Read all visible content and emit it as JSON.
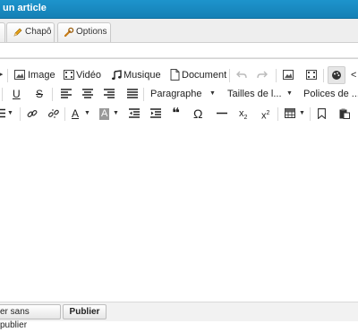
{
  "window": {
    "title": "un article"
  },
  "tabs": [
    {
      "label": "Chapô",
      "icon": "pencil-icon"
    },
    {
      "label": "Options",
      "icon": "wrench-icon"
    }
  ],
  "toolbar": {
    "row1": {
      "image": "Image",
      "video": "Vidéo",
      "music": "Musique",
      "document": "Document"
    },
    "row2": {
      "format": "Paragraphe",
      "font_size": "Tailles de l...",
      "font_family": "Polices de ..."
    }
  },
  "footer": {
    "save_without_publish": "er sans publier",
    "publish": "Publier"
  },
  "colors": {
    "titlebar": "#1580b5",
    "accent_green": "#2a8a2a"
  }
}
